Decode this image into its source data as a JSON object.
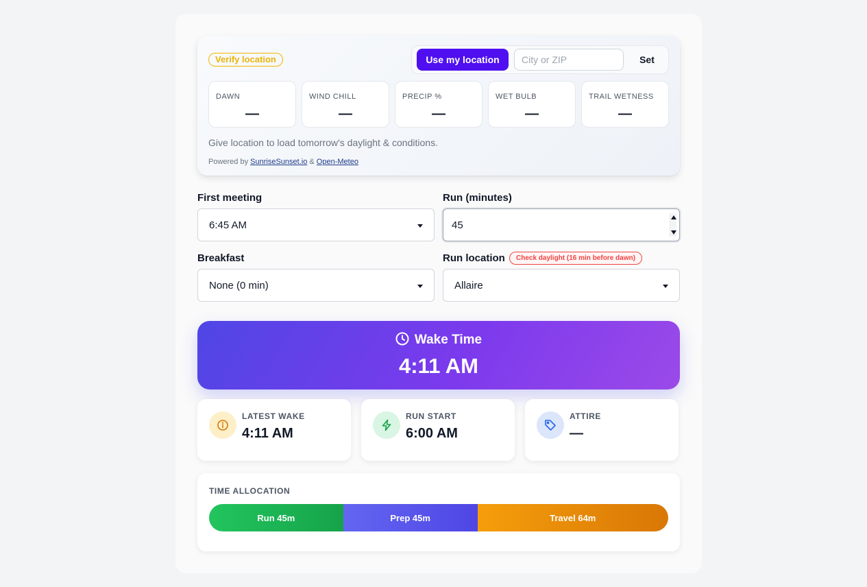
{
  "location": {
    "verify_label": "Verify location",
    "use_location_label": "Use my location",
    "city_placeholder": "City or ZIP",
    "set_label": "Set",
    "metrics": [
      {
        "label": "DAWN",
        "value": "—"
      },
      {
        "label": "WIND CHILL",
        "value": "—"
      },
      {
        "label": "PRECIP %",
        "value": "—"
      },
      {
        "label": "WET BULB",
        "value": "—"
      },
      {
        "label": "TRAIL WETNESS",
        "value": "—"
      }
    ],
    "message": "Give location to load tomorrow's daylight & conditions.",
    "powered_prefix": "Powered by",
    "powered_link1": "SunriseSunset.io",
    "powered_amp": "&",
    "powered_link2": "Open-Meteo"
  },
  "form": {
    "first_meeting_label": "First meeting",
    "first_meeting_value": "6:45 AM",
    "run_minutes_label": "Run (minutes)",
    "run_minutes_value": "45",
    "breakfast_label": "Breakfast",
    "breakfast_value": "None (0 min)",
    "run_location_label": "Run location",
    "run_location_value": "Allaire",
    "daylight_warning": "Check daylight (16 min before dawn)"
  },
  "wake": {
    "title": "Wake Time",
    "time": "4:11 AM"
  },
  "stats": [
    {
      "label": "LATEST WAKE",
      "value": "4:11 AM",
      "icon": "info-icon",
      "color": "#d97706"
    },
    {
      "label": "RUN START",
      "value": "6:00 AM",
      "icon": "lightning-icon",
      "color": "#16a34a"
    },
    {
      "label": "ATTIRE",
      "value": "—",
      "icon": "tag-icon",
      "color": "#2563eb"
    }
  ],
  "allocation": {
    "title": "TIME ALLOCATION",
    "segments": [
      {
        "label": "Run 45m",
        "minutes": 45,
        "color_from": "#22c55e",
        "color_to": "#16a34a"
      },
      {
        "label": "Prep 45m",
        "minutes": 45,
        "color_from": "#6366f1",
        "color_to": "#4f46e5"
      },
      {
        "label": "Travel 64m",
        "minutes": 64,
        "color_from": "#f59e0b",
        "color_to": "#d97706"
      }
    ]
  },
  "colors": {
    "accent": "#4f0ff0",
    "hero_from": "#4f46e5",
    "hero_to": "#9b4ae8",
    "warning": "#ef4444",
    "verify": "#eab308"
  }
}
